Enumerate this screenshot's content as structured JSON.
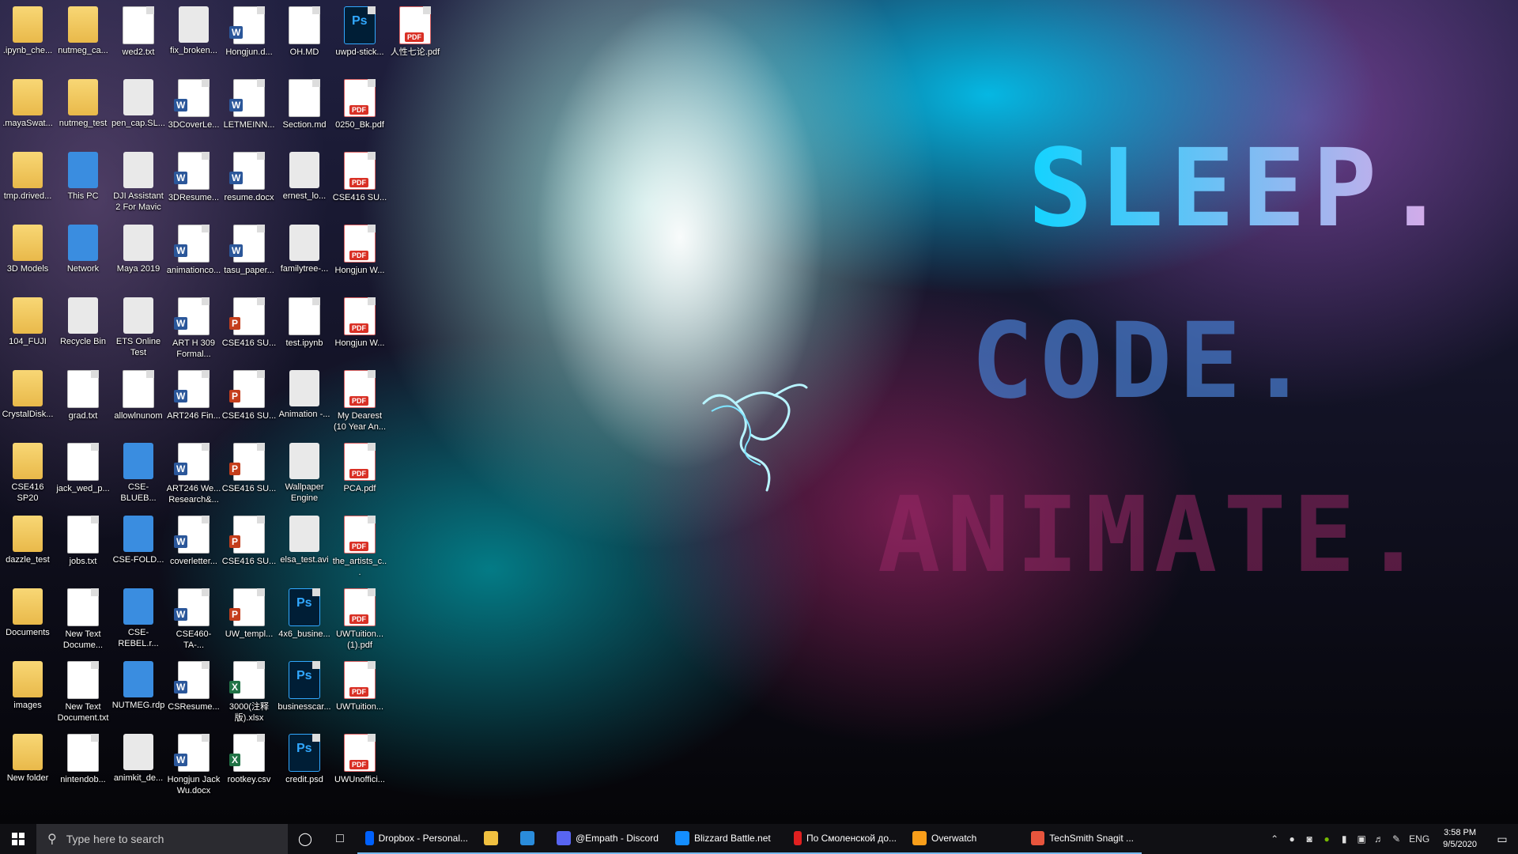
{
  "desktop": {
    "wordmark": [
      "SLEEP.",
      "CODE.",
      "ANIMATE."
    ],
    "icons": [
      {
        "label": ".ipynb_che...",
        "type": "folder"
      },
      {
        "label": ".mayaSwat...",
        "type": "folder"
      },
      {
        "label": "tmp.drived...",
        "type": "folder"
      },
      {
        "label": "3D Models",
        "type": "folder"
      },
      {
        "label": "104_FUJI",
        "type": "folder"
      },
      {
        "label": "CrystalDisk...",
        "type": "folder"
      },
      {
        "label": "CSE416 SP20",
        "type": "folder"
      },
      {
        "label": "dazzle_test",
        "type": "folder"
      },
      {
        "label": "Documents",
        "type": "folder"
      },
      {
        "label": "images",
        "type": "folder"
      },
      {
        "label": "New folder",
        "type": "folder"
      },
      {
        "label": "nutmeg_ca...",
        "type": "folder"
      },
      {
        "label": "nutmeg_test",
        "type": "folder"
      },
      {
        "label": "This PC",
        "type": "pc"
      },
      {
        "label": "Network",
        "type": "pc"
      },
      {
        "label": "Recycle Bin",
        "type": "gen"
      },
      {
        "label": "grad.txt",
        "type": "doc"
      },
      {
        "label": "jack_wed_p...",
        "type": "doc"
      },
      {
        "label": "jobs.txt",
        "type": "doc"
      },
      {
        "label": "New Text Docume...",
        "type": "doc"
      },
      {
        "label": "New Text Document.txt",
        "type": "doc"
      },
      {
        "label": "nintendob...",
        "type": "doc"
      },
      {
        "label": "wed2.txt",
        "type": "doc"
      },
      {
        "label": "pen_cap.SL...",
        "type": "gen"
      },
      {
        "label": "DJI Assistant 2 For Mavic",
        "type": "gen"
      },
      {
        "label": "Maya 2019",
        "type": "gen"
      },
      {
        "label": "ETS Online Test",
        "type": "gen"
      },
      {
        "label": "allowlnunom",
        "type": "doc"
      },
      {
        "label": "CSE-BLUEB...",
        "type": "pc"
      },
      {
        "label": "CSE-FOLD...",
        "type": "pc"
      },
      {
        "label": "CSE-REBEL.r...",
        "type": "pc"
      },
      {
        "label": "NUTMEG.rdp",
        "type": "pc"
      },
      {
        "label": "animkit_de...",
        "type": "gen"
      },
      {
        "label": "fix_broken...",
        "type": "gen"
      },
      {
        "label": "3DCoverLe...",
        "type": "word"
      },
      {
        "label": "3DResume...",
        "type": "word"
      },
      {
        "label": "animationco...",
        "type": "word"
      },
      {
        "label": "ART H 309 Formal...",
        "type": "word"
      },
      {
        "label": "ART246 Fin...",
        "type": "word"
      },
      {
        "label": "ART246 We... Research&...",
        "type": "word"
      },
      {
        "label": "coverletter...",
        "type": "word"
      },
      {
        "label": "CSE460-TA-...",
        "type": "word"
      },
      {
        "label": "CSResume...",
        "type": "word"
      },
      {
        "label": "Hongjun Jack Wu.docx",
        "type": "word"
      },
      {
        "label": "Hongjun.d...",
        "type": "word"
      },
      {
        "label": "LETMEINN...",
        "type": "word"
      },
      {
        "label": "resume.docx",
        "type": "word"
      },
      {
        "label": "tasu_paper...",
        "type": "word"
      },
      {
        "label": "CSE416 SU...",
        "type": "ppt"
      },
      {
        "label": "CSE416 SU...",
        "type": "ppt"
      },
      {
        "label": "CSE416 SU...",
        "type": "ppt"
      },
      {
        "label": "CSE416 SU...",
        "type": "ppt"
      },
      {
        "label": "UW_templ...",
        "type": "ppt"
      },
      {
        "label": "3000(注释版).xlsx",
        "type": "xls"
      },
      {
        "label": "rootkey.csv",
        "type": "xls"
      },
      {
        "label": "OH.MD",
        "type": "doc"
      },
      {
        "label": "Section.md",
        "type": "doc"
      },
      {
        "label": "ernest_lo...",
        "type": "gen"
      },
      {
        "label": "familytree-...",
        "type": "gen"
      },
      {
        "label": "test.ipynb",
        "type": "doc"
      },
      {
        "label": "Animation -...",
        "type": "gen"
      },
      {
        "label": "Wallpaper Engine",
        "type": "gen"
      },
      {
        "label": "elsa_test.avi",
        "type": "gen"
      },
      {
        "label": "4x6_busine...",
        "type": "ps"
      },
      {
        "label": "businesscar...",
        "type": "ps"
      },
      {
        "label": "credit.psd",
        "type": "ps"
      },
      {
        "label": "uwpd-stick...",
        "type": "ps"
      },
      {
        "label": "0250_Bk.pdf",
        "type": "pdf"
      },
      {
        "label": "CSE416 SU...",
        "type": "pdf"
      },
      {
        "label": "Hongjun W...",
        "type": "pdf"
      },
      {
        "label": "Hongjun W...",
        "type": "pdf"
      },
      {
        "label": "My Dearest (10 Year An...",
        "type": "pdf"
      },
      {
        "label": "PCA.pdf",
        "type": "pdf"
      },
      {
        "label": "the_artists_c...",
        "type": "pdf"
      },
      {
        "label": "UWTuition... (1).pdf",
        "type": "pdf"
      },
      {
        "label": "UWTuition...",
        "type": "pdf"
      },
      {
        "label": "UWUnoffici...",
        "type": "pdf"
      },
      {
        "label": "人性七论.pdf",
        "type": "pdf"
      }
    ]
  },
  "taskbar": {
    "search_placeholder": "Type here to search",
    "apps": [
      {
        "label": "Dropbox - Personal...",
        "color": "#0061fe"
      },
      {
        "label": "",
        "color": "#f0c040"
      },
      {
        "label": "",
        "color": "#2a8cdb"
      },
      {
        "label": "@Empath - Discord",
        "color": "#5865f2"
      },
      {
        "label": "Blizzard Battle.net",
        "color": "#148eff"
      },
      {
        "label": "По Смоленской до...",
        "color": "#e02020"
      },
      {
        "label": "Overwatch",
        "color": "#f99e1a"
      },
      {
        "label": "TechSmith Snagit ...",
        "color": "#e8553d"
      }
    ],
    "language": "ENG",
    "time": "3:58 PM",
    "date": "9/5/2020"
  }
}
